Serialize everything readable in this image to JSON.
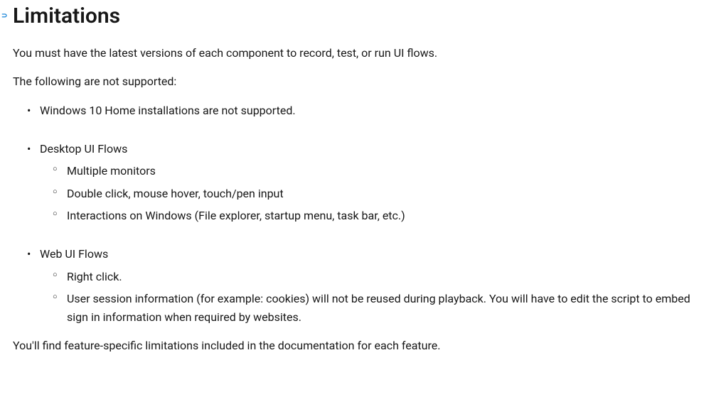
{
  "heading": "Limitations",
  "intro": "You must have the latest versions of each component to record, test, or run UI flows.",
  "not_supported_intro": "The following are not supported:",
  "items": [
    {
      "text": "Windows 10 Home installations are not supported."
    },
    {
      "text": "Desktop UI Flows",
      "sub": [
        "Multiple monitors",
        "Double click, mouse hover, touch/pen input",
        "Interactions on Windows (File explorer, startup menu, task bar, etc.)"
      ]
    },
    {
      "text": "Web UI Flows",
      "sub": [
        "Right click.",
        "User session information (for example: cookies) will not be reused during playback. You will have to edit the script to embed sign in information when required by websites."
      ]
    }
  ],
  "outro": "You'll find feature-specific limitations included in the documentation for each feature."
}
